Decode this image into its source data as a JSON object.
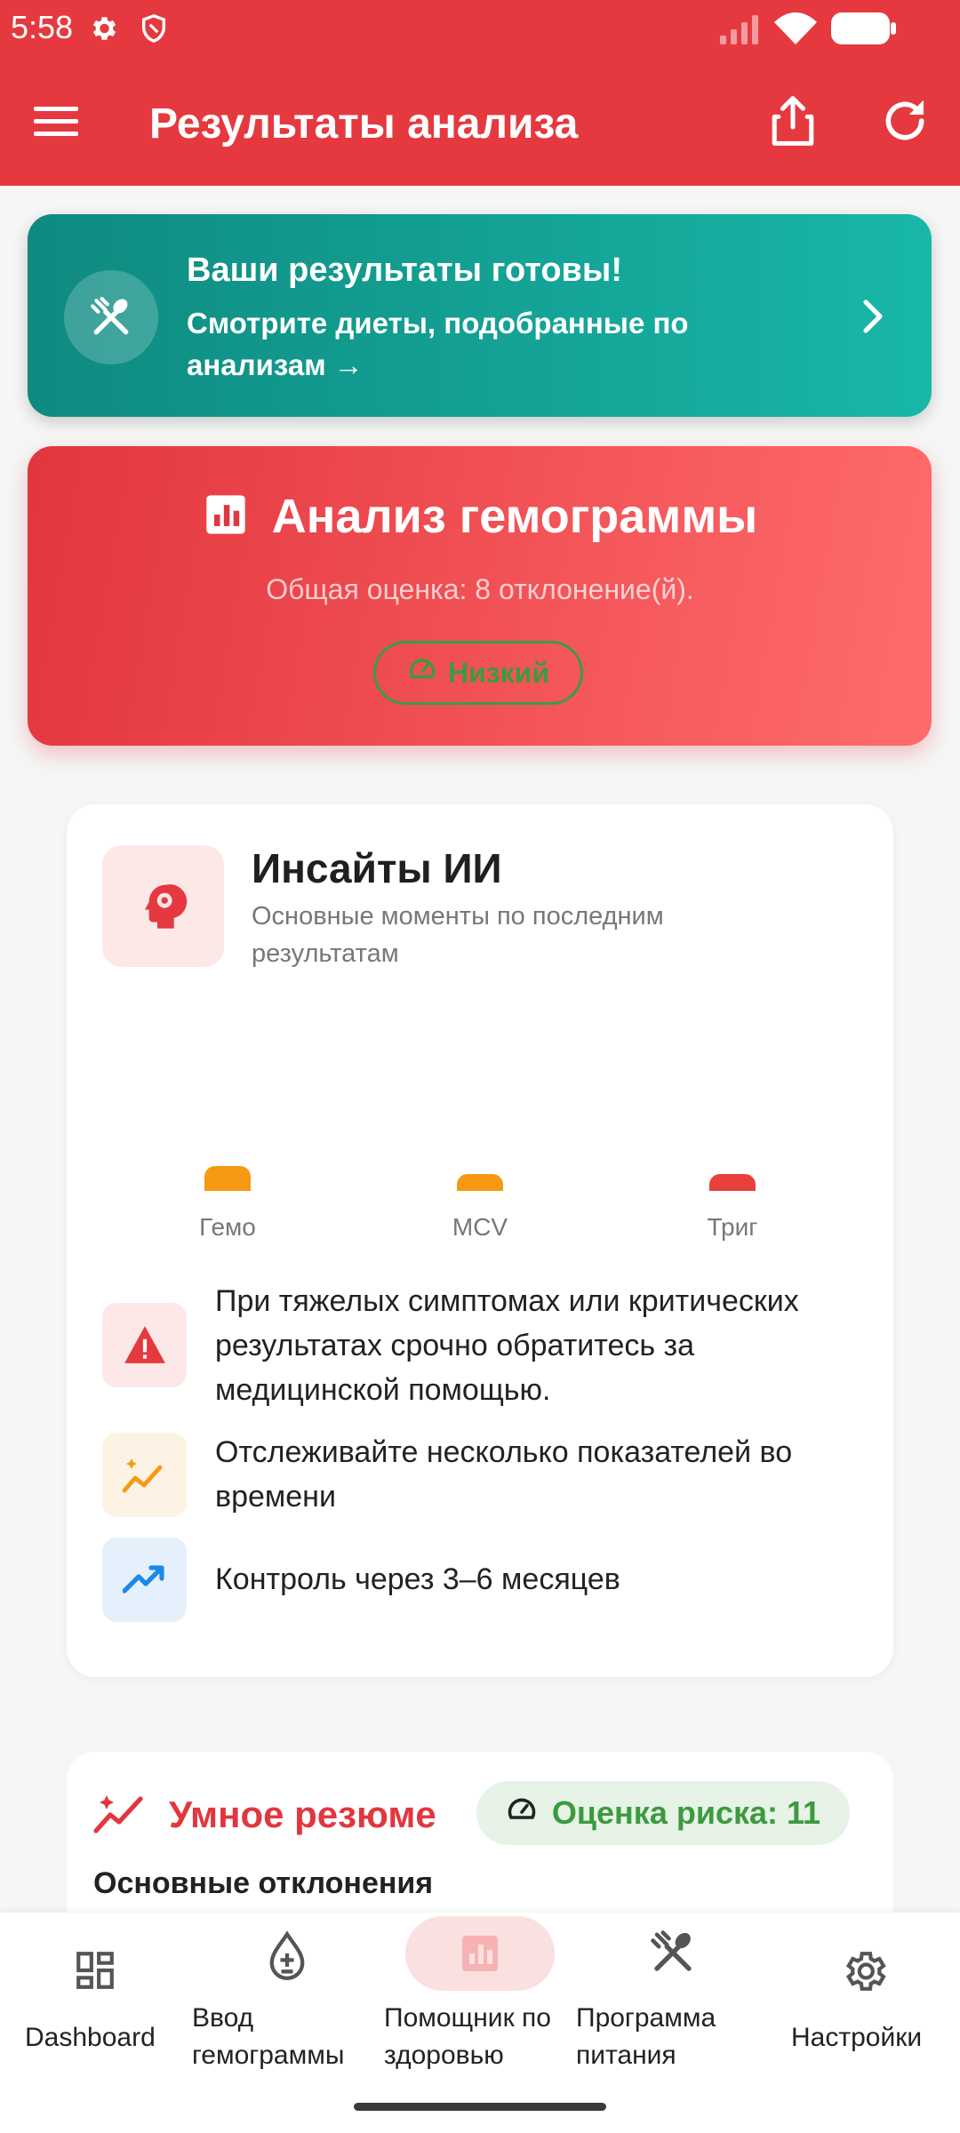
{
  "status": {
    "time": "5:58"
  },
  "header": {
    "title": "Результаты анализа"
  },
  "banner": {
    "title": "Ваши результаты готовы!",
    "subtitle": "Смотрите диеты, подобранные по анализам →"
  },
  "analysis": {
    "title": "Анализ гемограммы",
    "summary": "Общая оценка: 8 отклонение(й).",
    "level": "Низкий"
  },
  "insights": {
    "title": "Инсайты ИИ",
    "subtitle": "Основные моменты по последним результатам",
    "bars": [
      {
        "label": "Гемо",
        "color": "#f59a12"
      },
      {
        "label": "MCV",
        "color": "#f59a12"
      },
      {
        "label": "Триг",
        "color": "#e8413c"
      }
    ],
    "tips": [
      {
        "icon": "warning-icon",
        "text": "При тяжелых симптомах или критических результатах срочно обратитесь за медицинской помощью."
      },
      {
        "icon": "sparkle-chart-icon",
        "text": "Отслеживайте несколько показателей во времени"
      },
      {
        "icon": "trending-up-icon",
        "text": "Контроль через 3–6 месяцев"
      }
    ]
  },
  "summary": {
    "title": "Умное резюме",
    "risk": "Оценка риска: 11",
    "section": "Основные отклонения"
  },
  "nav": [
    {
      "label": "Dashboard"
    },
    {
      "label": "Ввод гемограммы"
    },
    {
      "label": "Помощник по здоровью"
    },
    {
      "label": "Программа питания"
    },
    {
      "label": "Настройки"
    }
  ],
  "colors": {
    "primary": "#e5393f",
    "teal": "#14a396",
    "green": "#3d9a3f"
  }
}
